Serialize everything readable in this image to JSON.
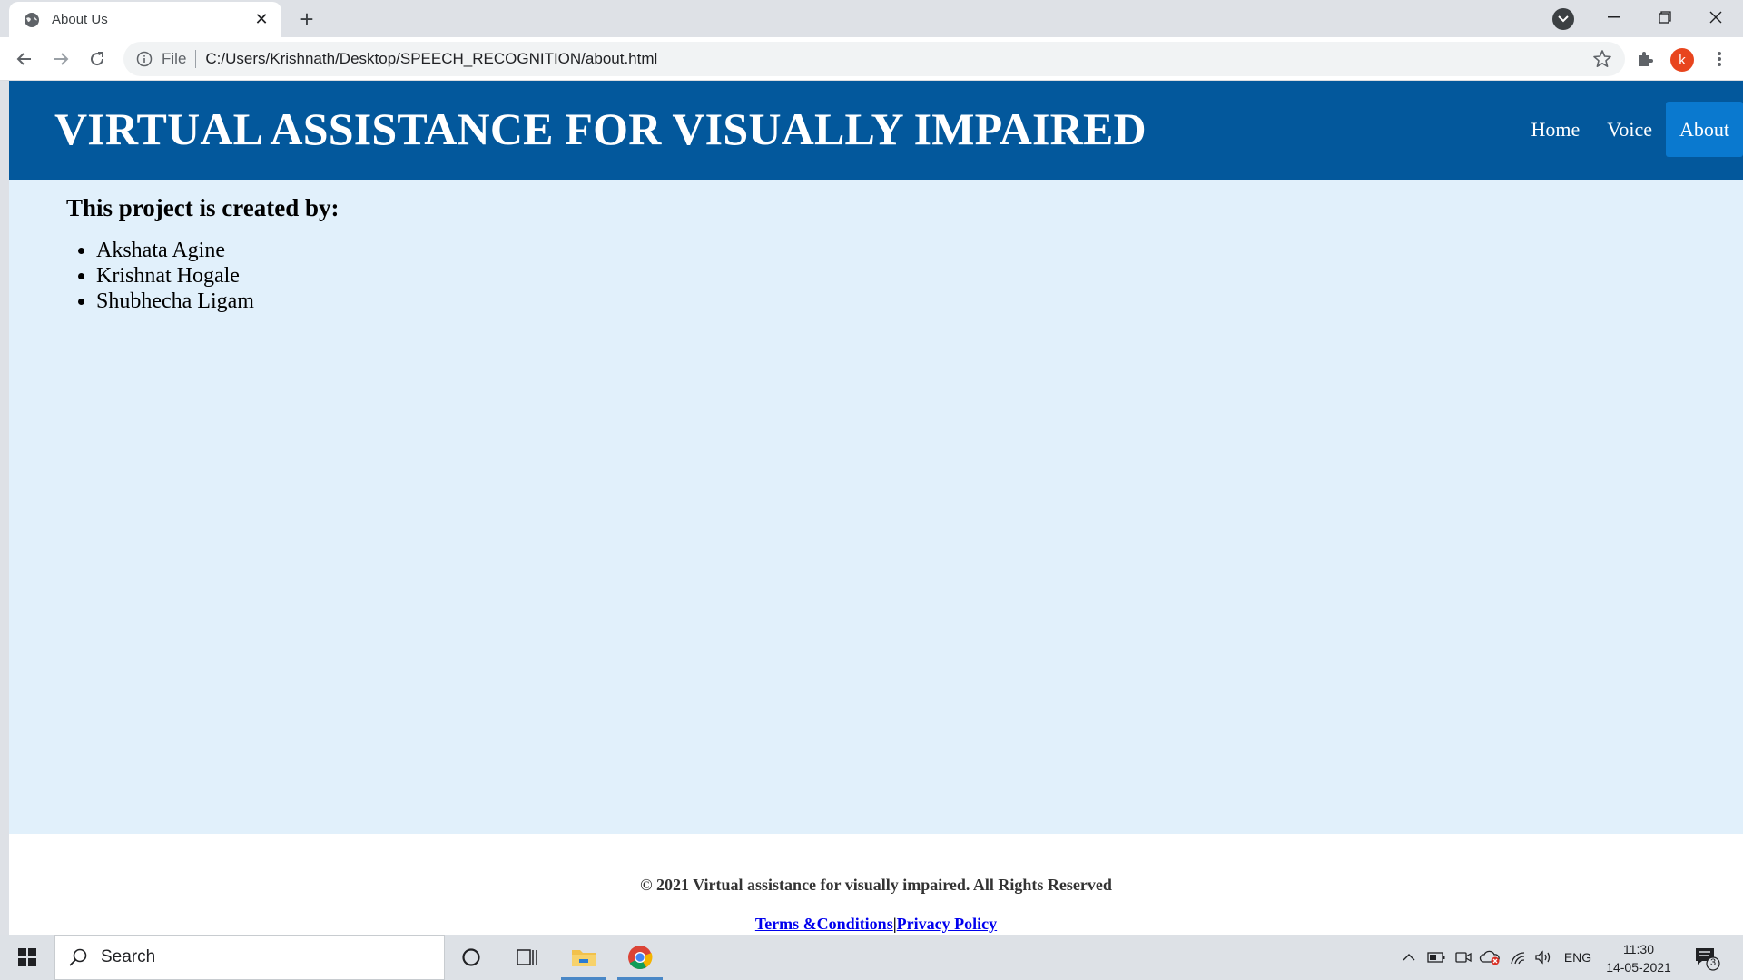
{
  "browser": {
    "tab_title": "About Us",
    "url_scheme": "File",
    "url": "C:/Users/Krishnath/Desktop/SPEECH_RECOGNITION/about.html",
    "profile_initial": "k"
  },
  "site": {
    "title": "VIRTUAL ASSISTANCE FOR VISUALLY IMPAIRED",
    "nav": [
      {
        "label": "Home",
        "active": false
      },
      {
        "label": "Voice",
        "active": false
      },
      {
        "label": "About",
        "active": true
      }
    ],
    "colors": {
      "header_bg": "#03589c",
      "active_nav": "#0a79cf",
      "page_bg": "#e1f0fb"
    }
  },
  "content": {
    "heading": "This project is created by:",
    "creators": [
      "Akshata Agine",
      "Krishnat Hogale",
      "Shubhecha Ligam"
    ]
  },
  "footer": {
    "copyright": "© 2021 Virtual assistance for visually impaired. All Rights Reserved",
    "terms_label": "Terms &Conditions",
    "separator": "|",
    "privacy_label": "Privacy Policy"
  },
  "taskbar": {
    "search_label": "Search",
    "language": "ENG",
    "time": "11:30",
    "date": "14-05-2021",
    "notification_count": "3"
  }
}
